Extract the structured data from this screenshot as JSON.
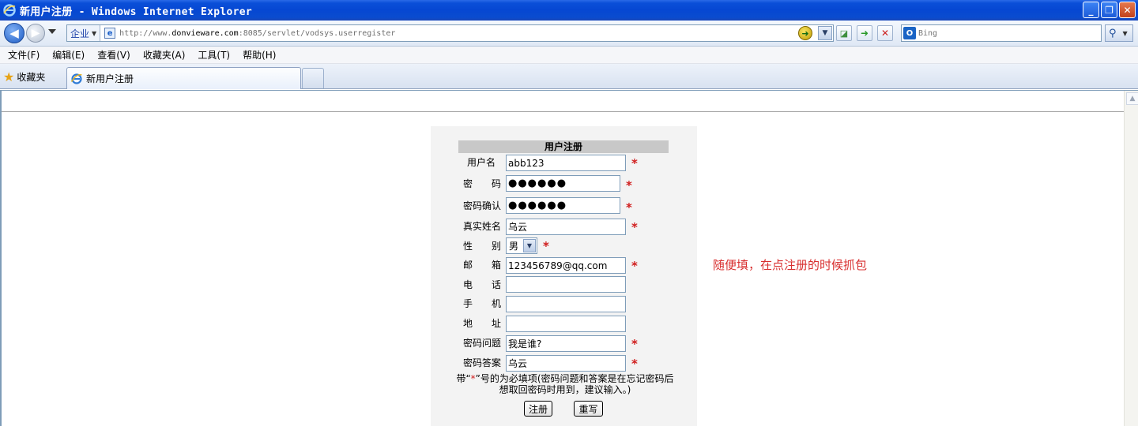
{
  "window": {
    "title": "新用户注册 - Windows Internet Explorer",
    "controls": [
      "minimize-button",
      "restore-button",
      "close-button"
    ]
  },
  "addressbar": {
    "zone_label": "企业",
    "url_prefix": "http://www.",
    "url_host": "donvieware.com",
    "url_suffix": ":8085/servlet/vodsys.userregister",
    "search_placeholder": "Bing"
  },
  "menubar": {
    "items": [
      "文件(F)",
      "编辑(E)",
      "查看(V)",
      "收藏夹(A)",
      "工具(T)",
      "帮助(H)"
    ]
  },
  "tabbar": {
    "favorites_label": "收藏夹",
    "active_tab": "新用户注册"
  },
  "form": {
    "title": "用户注册",
    "fields": {
      "username": {
        "label": "用户名",
        "value": "abb123"
      },
      "password": {
        "label": "密　　码",
        "value": "●●●●●●"
      },
      "confirm": {
        "label": "密码确认",
        "value": "●●●●●●"
      },
      "realname": {
        "label": "真实姓名",
        "value": "乌云"
      },
      "gender": {
        "label": "性　　别",
        "value": "男"
      },
      "email": {
        "label": "邮　　箱",
        "value": "123456789@qq.com"
      },
      "phone": {
        "label": "电　　话",
        "value": ""
      },
      "mobile": {
        "label": "手　　机",
        "value": ""
      },
      "address": {
        "label": "地　　址",
        "value": ""
      },
      "question": {
        "label": "密码问题",
        "value": "我是谁?"
      },
      "answer": {
        "label": "密码答案",
        "value": "乌云"
      }
    },
    "required_mark": "*",
    "note_before": "带“",
    "note_star": "*",
    "note_after": "”号的为必填项(密码问题和答案是在忘记密码后想取回密码时用到，建议输入。)",
    "submit_label": "注册",
    "reset_label": "重写"
  },
  "annotation": "随便填，在点注册的时候抓包"
}
